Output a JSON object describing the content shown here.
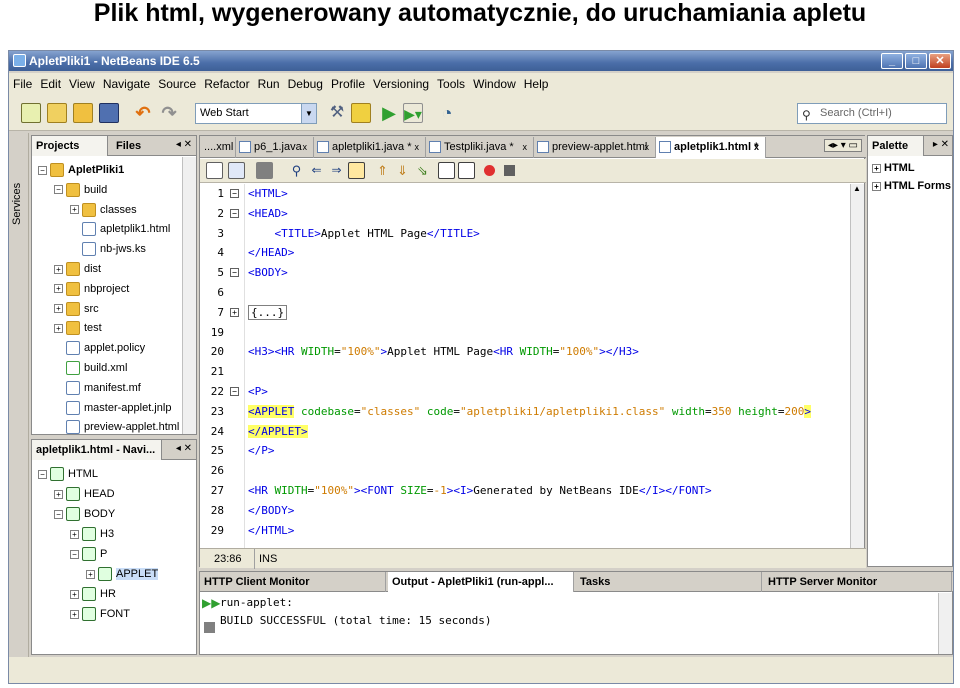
{
  "slide_title": "Plik html, wygenerowany automatycznie, do uruchamiania apletu",
  "window": {
    "title": "ApletPliki1 - NetBeans IDE 6.5",
    "controls": [
      "_",
      "□",
      "✕"
    ]
  },
  "menu": [
    "File",
    "Edit",
    "View",
    "Navigate",
    "Source",
    "Refactor",
    "Run",
    "Debug",
    "Profile",
    "Versioning",
    "Tools",
    "Window",
    "Help"
  ],
  "toolbar": {
    "config_value": "Web Start",
    "search_placeholder": "Search (Ctrl+I)"
  },
  "services_label": "Services",
  "projects": {
    "tabs": [
      "Projects",
      "Files"
    ],
    "tree": [
      {
        "label": "ApletPliki1",
        "depth": 0,
        "exp": "−",
        "icon": "folder",
        "bold": true
      },
      {
        "label": "build",
        "depth": 1,
        "exp": "−",
        "icon": "folder"
      },
      {
        "label": "classes",
        "depth": 2,
        "exp": "+",
        "icon": "folder"
      },
      {
        "label": "apletplik1.html",
        "depth": 2,
        "exp": "",
        "icon": "file"
      },
      {
        "label": "nb-jws.ks",
        "depth": 2,
        "exp": "",
        "icon": "file"
      },
      {
        "label": "dist",
        "depth": 1,
        "exp": "+",
        "icon": "folder"
      },
      {
        "label": "nbproject",
        "depth": 1,
        "exp": "+",
        "icon": "folder"
      },
      {
        "label": "src",
        "depth": 1,
        "exp": "+",
        "icon": "folder"
      },
      {
        "label": "test",
        "depth": 1,
        "exp": "+",
        "icon": "folder"
      },
      {
        "label": "applet.policy",
        "depth": 1,
        "exp": "",
        "icon": "file"
      },
      {
        "label": "build.xml",
        "depth": 1,
        "exp": "",
        "icon": "xml"
      },
      {
        "label": "manifest.mf",
        "depth": 1,
        "exp": "",
        "icon": "file"
      },
      {
        "label": "master-applet.jnlp",
        "depth": 1,
        "exp": "",
        "icon": "file"
      },
      {
        "label": "preview-applet.html",
        "depth": 1,
        "exp": "",
        "icon": "file"
      }
    ]
  },
  "navigator": {
    "title": "apletplik1.html - Navi...",
    "tree": [
      {
        "label": "HTML",
        "depth": 0,
        "exp": "−"
      },
      {
        "label": "HEAD",
        "depth": 1,
        "exp": "+"
      },
      {
        "label": "BODY",
        "depth": 1,
        "exp": "−"
      },
      {
        "label": "H3",
        "depth": 2,
        "exp": "+"
      },
      {
        "label": "P",
        "depth": 2,
        "exp": "−"
      },
      {
        "label": "APPLET",
        "depth": 3,
        "exp": "+",
        "selected": true
      },
      {
        "label": "HR",
        "depth": 2,
        "exp": "+"
      },
      {
        "label": "FONT",
        "depth": 2,
        "exp": "+"
      }
    ]
  },
  "editor": {
    "tabs": [
      {
        "label": "....xml",
        "close": ""
      },
      {
        "label": "p6_1.java",
        "close": "x"
      },
      {
        "label": "apletpliki1.java *",
        "close": "x"
      },
      {
        "label": "Testpliki.java *",
        "close": "x"
      },
      {
        "label": "preview-applet.html",
        "close": "x"
      },
      {
        "label": "apletplik1.html *",
        "close": "x"
      }
    ],
    "lines": [
      {
        "n": "1",
        "fold": "−",
        "parts": [
          {
            "t": "<HTML>",
            "c": "tg"
          }
        ]
      },
      {
        "n": "2",
        "fold": "−",
        "parts": [
          {
            "t": "<HEAD>",
            "c": "tg"
          }
        ]
      },
      {
        "n": "3",
        "fold": "",
        "parts": [
          {
            "t": "    <TITLE>",
            "c": "tg"
          },
          {
            "t": "Applet HTML Page",
            "c": ""
          },
          {
            "t": "</TITLE>",
            "c": "tg"
          }
        ]
      },
      {
        "n": "4",
        "fold": "",
        "parts": [
          {
            "t": "</HEAD>",
            "c": "tg"
          }
        ]
      },
      {
        "n": "5",
        "fold": "−",
        "parts": [
          {
            "t": "<BODY>",
            "c": "tg"
          }
        ]
      },
      {
        "n": "6",
        "fold": "",
        "parts": []
      },
      {
        "n": "7",
        "fold": "+",
        "parts": [
          {
            "t": "{...}",
            "c": "fb"
          }
        ]
      },
      {
        "n": "19",
        "fold": "",
        "parts": []
      },
      {
        "n": "20",
        "fold": "",
        "parts": [
          {
            "t": "<H3><HR ",
            "c": "tg"
          },
          {
            "t": "WIDTH",
            "c": "at"
          },
          {
            "t": "=",
            "c": ""
          },
          {
            "t": "\"100%\"",
            "c": "vl"
          },
          {
            "t": ">",
            "c": "tg"
          },
          {
            "t": "Applet HTML Page",
            "c": ""
          },
          {
            "t": "<HR ",
            "c": "tg"
          },
          {
            "t": "WIDTH",
            "c": "at"
          },
          {
            "t": "=",
            "c": ""
          },
          {
            "t": "\"100%\"",
            "c": "vl"
          },
          {
            "t": "></H3>",
            "c": "tg"
          }
        ]
      },
      {
        "n": "21",
        "fold": "",
        "parts": []
      },
      {
        "n": "22",
        "fold": "−",
        "parts": [
          {
            "t": "<P>",
            "c": "tg"
          }
        ]
      },
      {
        "n": "23",
        "fold": "",
        "parts": [
          {
            "t": "<APPLET",
            "c": "tg hl"
          },
          {
            "t": " codebase",
            "c": "at"
          },
          {
            "t": "=",
            "c": ""
          },
          {
            "t": "\"classes\"",
            "c": "vl"
          },
          {
            "t": " code",
            "c": "at"
          },
          {
            "t": "=",
            "c": ""
          },
          {
            "t": "\"apletpliki1/apletpliki1.class\"",
            "c": "vl"
          },
          {
            "t": " width",
            "c": "at"
          },
          {
            "t": "=",
            "c": ""
          },
          {
            "t": "350",
            "c": "vl"
          },
          {
            "t": " height",
            "c": "at"
          },
          {
            "t": "=",
            "c": ""
          },
          {
            "t": "200",
            "c": "vl"
          },
          {
            "t": ">",
            "c": "tg hl"
          }
        ]
      },
      {
        "n": "24",
        "fold": "",
        "parts": [
          {
            "t": "</APPLET>",
            "c": "tg hl"
          }
        ]
      },
      {
        "n": "25",
        "fold": "",
        "parts": [
          {
            "t": "</P>",
            "c": "tg"
          }
        ]
      },
      {
        "n": "26",
        "fold": "",
        "parts": []
      },
      {
        "n": "27",
        "fold": "",
        "parts": [
          {
            "t": "<HR ",
            "c": "tg"
          },
          {
            "t": "WIDTH",
            "c": "at"
          },
          {
            "t": "=",
            "c": ""
          },
          {
            "t": "\"100%\"",
            "c": "vl"
          },
          {
            "t": "><FONT ",
            "c": "tg"
          },
          {
            "t": "SIZE",
            "c": "at"
          },
          {
            "t": "=",
            "c": ""
          },
          {
            "t": "-1",
            "c": "vl"
          },
          {
            "t": "><I>",
            "c": "tg"
          },
          {
            "t": "Generated by NetBeans IDE",
            "c": ""
          },
          {
            "t": "</I></FONT>",
            "c": "tg"
          }
        ]
      },
      {
        "n": "28",
        "fold": "",
        "parts": [
          {
            "t": "</BODY>",
            "c": "tg"
          }
        ]
      },
      {
        "n": "29",
        "fold": "",
        "parts": [
          {
            "t": "</HTML>",
            "c": "tg"
          }
        ]
      }
    ],
    "status_pos": "23:86",
    "status_mode": "INS"
  },
  "palette": {
    "title": "Palette",
    "items": [
      "HTML",
      "HTML Forms"
    ]
  },
  "bottom": {
    "tabs": [
      "HTTP Client Monitor",
      "Output - ApletPliki1 (run-appl...",
      "Tasks",
      "HTTP Server Monitor"
    ],
    "output_lines": [
      "run-applet:",
      "BUILD SUCCESSFUL (total time: 15 seconds)"
    ]
  }
}
